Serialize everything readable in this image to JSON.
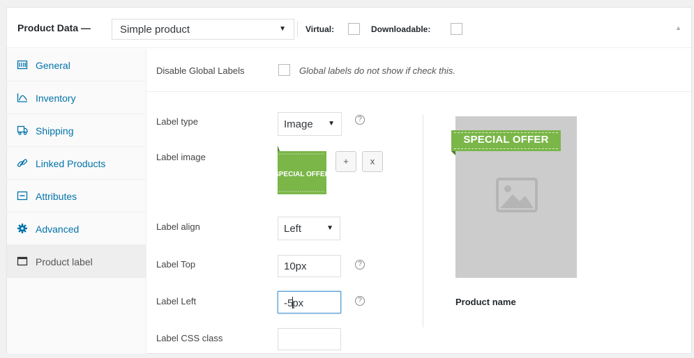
{
  "header": {
    "title": "Product Data —",
    "product_type": "Simple product",
    "virtual_label": "Virtual:",
    "downloadable_label": "Downloadable:",
    "virtual_checked": false,
    "downloadable_checked": false
  },
  "sidebar": {
    "items": [
      {
        "label": "General",
        "icon": "table-icon"
      },
      {
        "label": "Inventory",
        "icon": "chart-icon"
      },
      {
        "label": "Shipping",
        "icon": "truck-icon"
      },
      {
        "label": "Linked Products",
        "icon": "link-icon"
      },
      {
        "label": "Attributes",
        "icon": "list-icon"
      },
      {
        "label": "Advanced",
        "icon": "gear-icon"
      },
      {
        "label": "Product label",
        "icon": "window-icon",
        "active": true
      }
    ]
  },
  "form": {
    "disable_global_label": "Disable Global Labels",
    "disable_global_hint": "Global labels do not show if check this.",
    "label_type_label": "Label type",
    "label_type_value": "Image",
    "label_image_label": "Label image",
    "thumb_text": "SPECIAL OFFER",
    "add_button": "+",
    "remove_button": "x",
    "label_align_label": "Label align",
    "label_align_value": "Left",
    "label_top_label": "Label Top",
    "label_top_value": "10px",
    "label_left_label": "Label Left",
    "label_left_before_caret": "-5",
    "label_left_after_caret": "px",
    "label_css_label": "Label CSS class",
    "label_css_value": "",
    "help_glyph": "?"
  },
  "preview": {
    "ribbon_text": "SPECIAL OFFER",
    "product_name": "Product name"
  },
  "colors": {
    "accent_link": "#0073aa",
    "ribbon_green": "#7ab648",
    "placeholder_gray": "#cccccc"
  }
}
